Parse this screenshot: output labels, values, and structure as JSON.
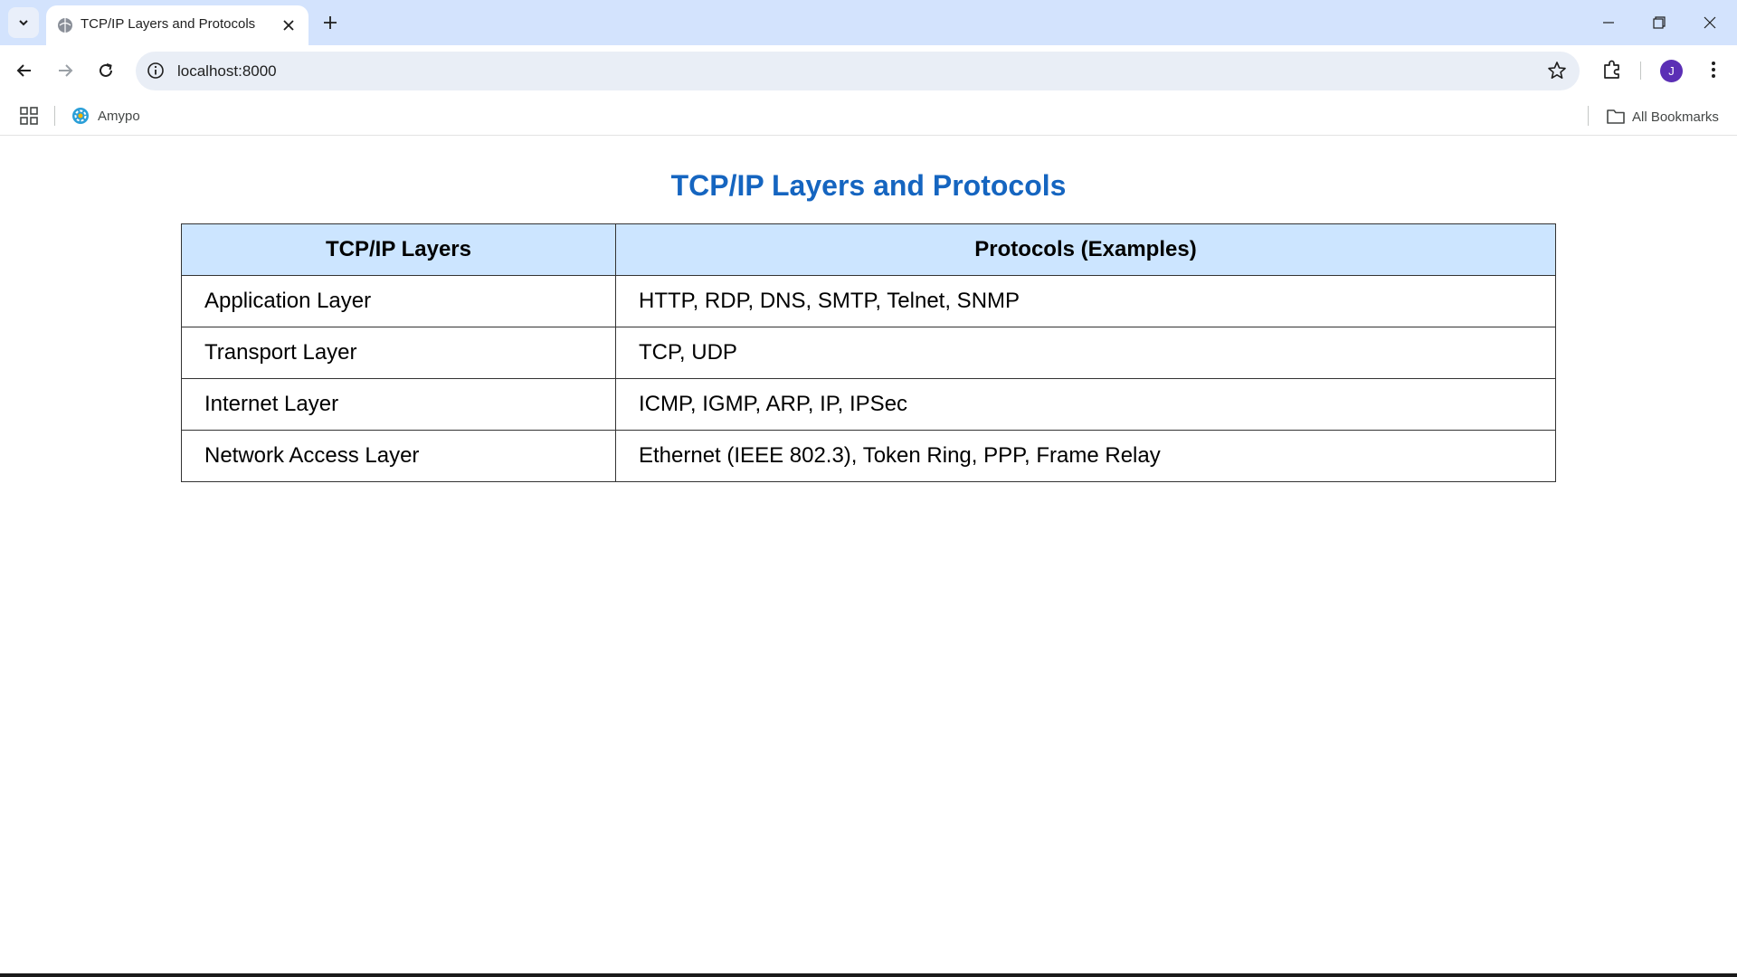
{
  "browser": {
    "tab": {
      "title": "TCP/IP Layers and Protocols",
      "favicon": "globe-icon"
    },
    "address_bar": {
      "url": "localhost:8000"
    },
    "profile": {
      "initial": "J",
      "color": "#5b2fb5"
    },
    "bookmarks": {
      "items": [
        {
          "label": "Amypo",
          "icon": "amypo-logo-icon"
        }
      ],
      "all_bookmarks_label": "All Bookmarks"
    }
  },
  "page": {
    "title": "TCP/IP Layers and Protocols",
    "title_color": "#1565c0",
    "table": {
      "headers": [
        "TCP/IP Layers",
        "Protocols (Examples)"
      ],
      "header_bg": "#cce5ff",
      "rows": [
        {
          "layer": "Application Layer",
          "protocols": "HTTP, RDP, DNS, SMTP, Telnet, SNMP"
        },
        {
          "layer": "Transport Layer",
          "protocols": "TCP, UDP"
        },
        {
          "layer": "Internet Layer",
          "protocols": "ICMP, IGMP, ARP, IP, IPSec"
        },
        {
          "layer": "Network Access Layer",
          "protocols": "Ethernet (IEEE 802.3), Token Ring, PPP, Frame Relay"
        }
      ]
    }
  }
}
